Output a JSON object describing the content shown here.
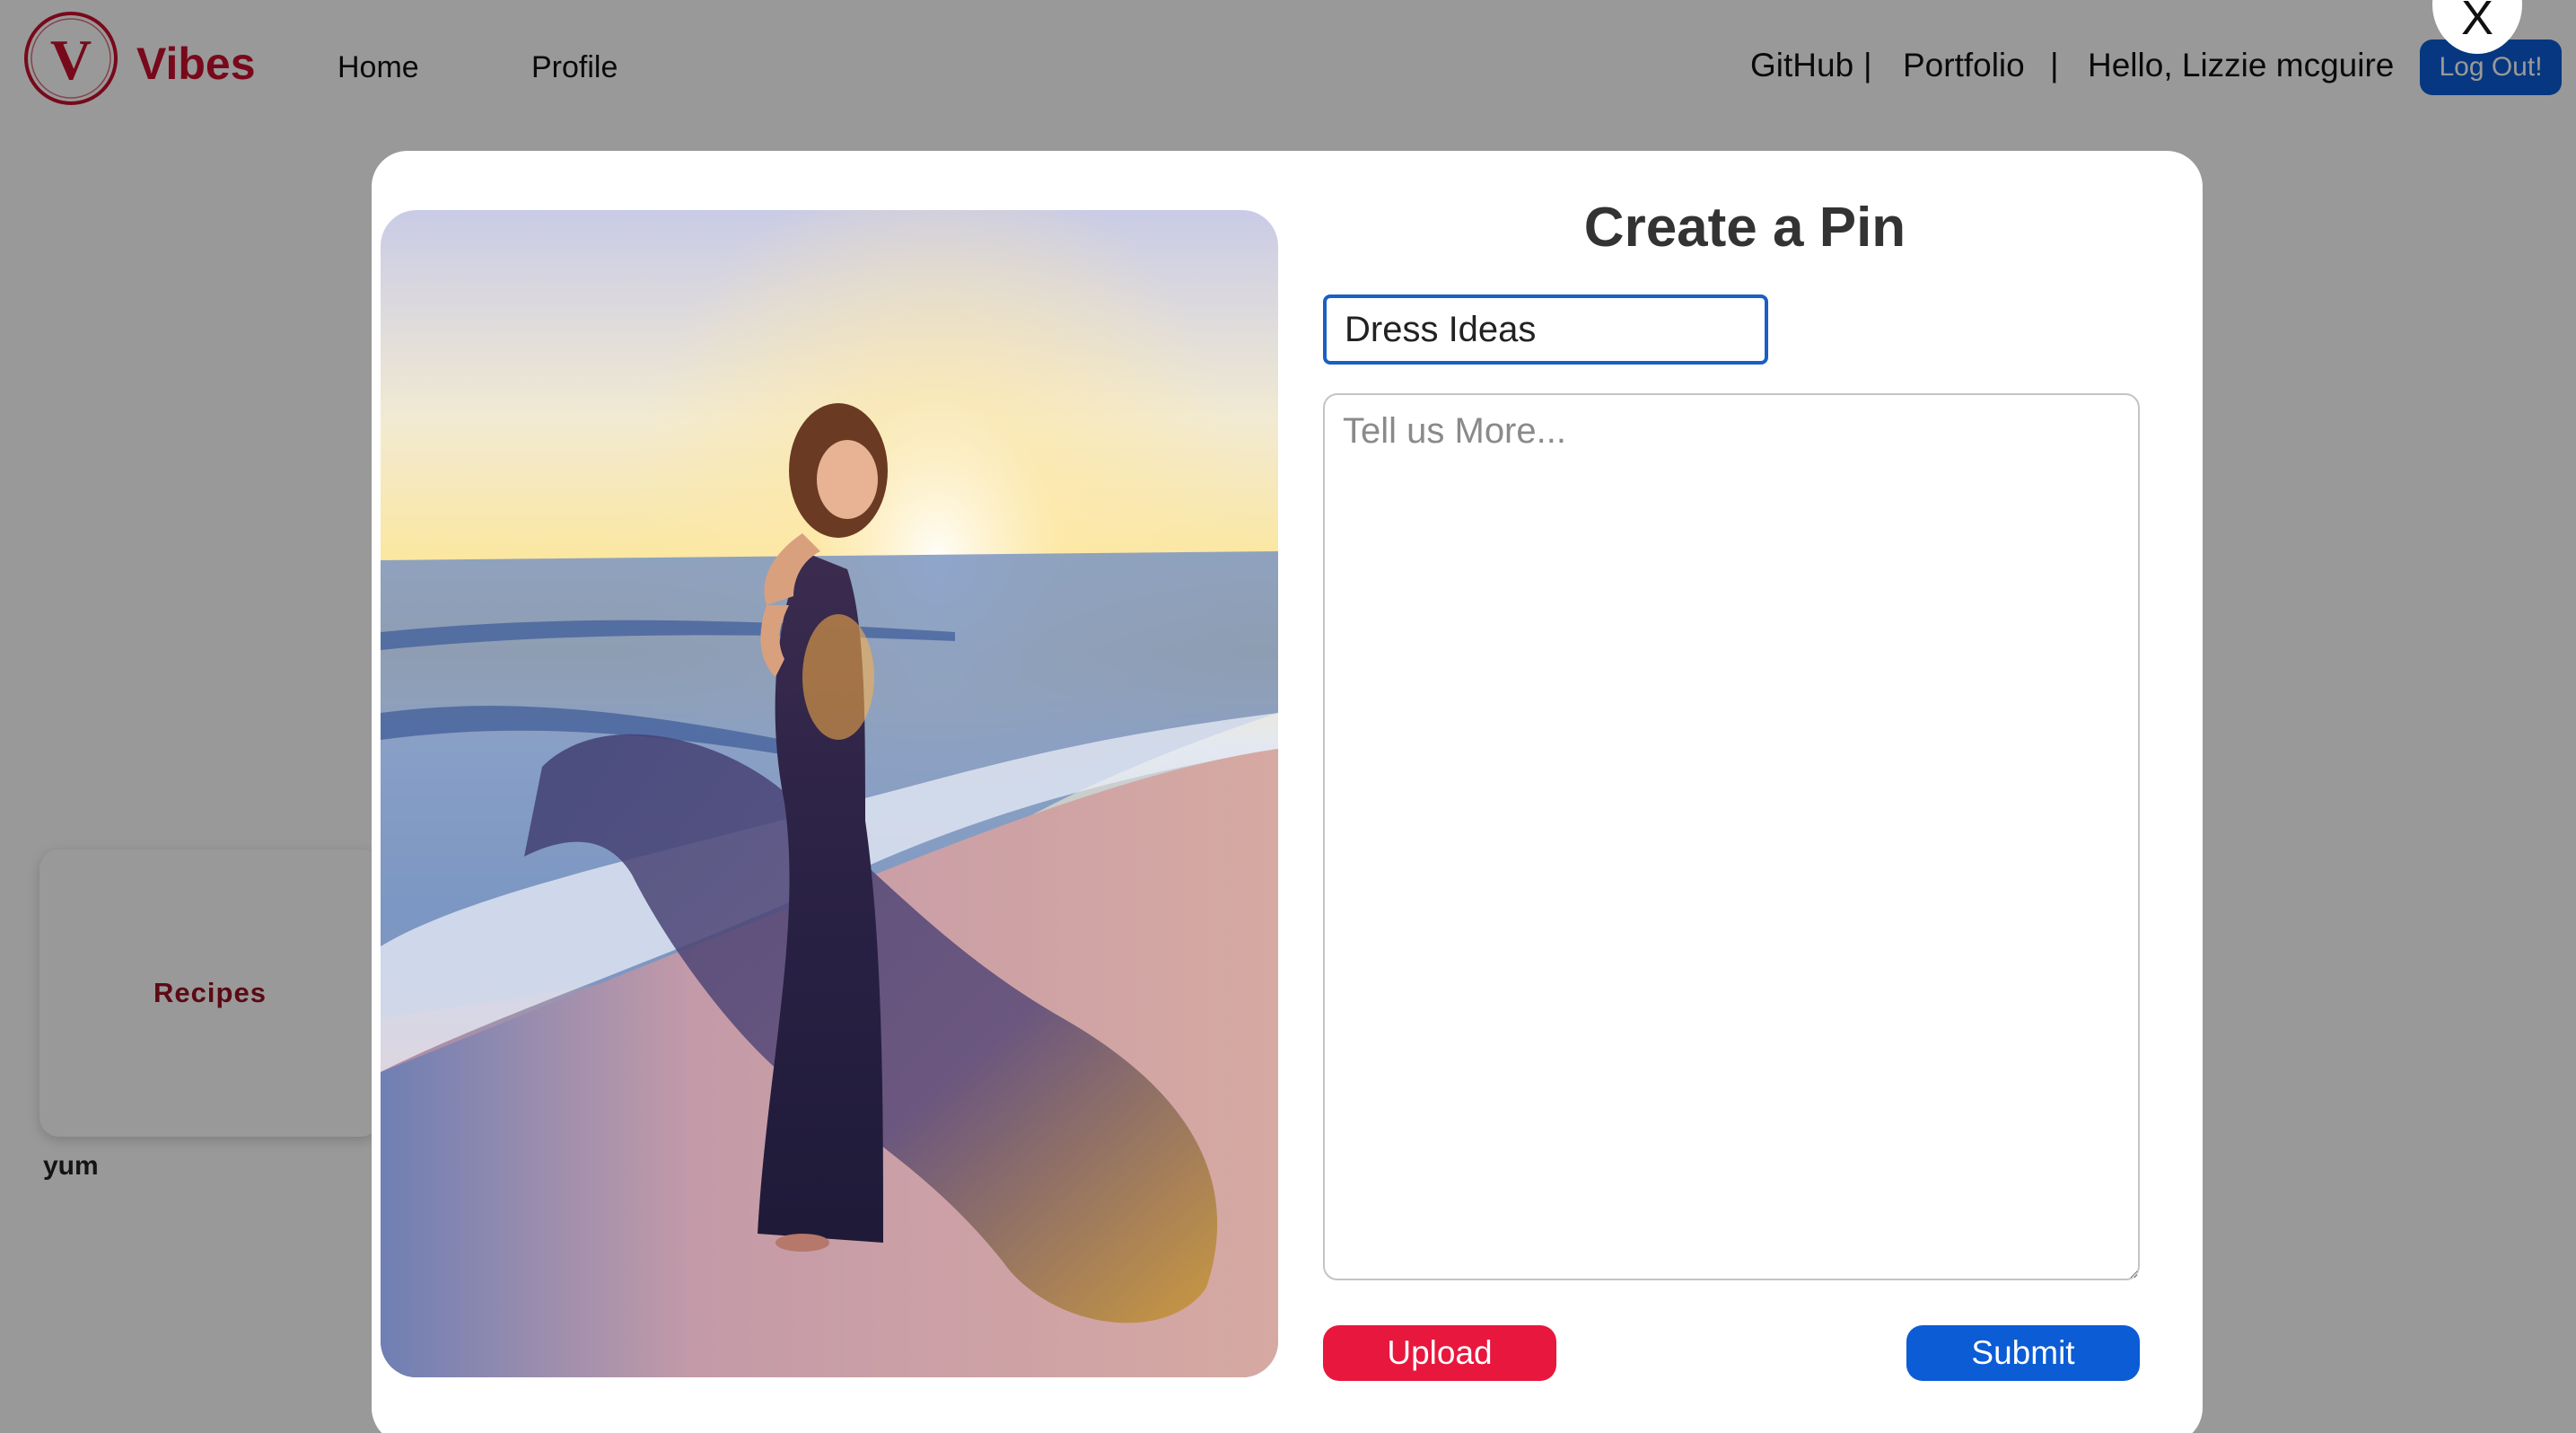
{
  "app": {
    "brand": "Vibes",
    "logo_letter": "V"
  },
  "nav": {
    "home": "Home",
    "profile": "Profile"
  },
  "top_right": {
    "github": "GitHub",
    "separator": "|",
    "portfolio": "Portfolio",
    "greeting": "Hello, Lizzie mcguire",
    "logout": "Log Out!"
  },
  "background": {
    "board_name": "Recipes",
    "board_caption": "yum"
  },
  "modal": {
    "close_label": "X",
    "title": "Create a Pin",
    "title_input_value": "Dress Ideas",
    "description_placeholder": "Tell us More...",
    "upload_label": "Upload",
    "submit_label": "Submit",
    "image_icon": "pin-photo"
  },
  "colors": {
    "brand_red": "#c8102e",
    "upload_red": "#e8173d",
    "primary_blue": "#0b5cd5"
  }
}
